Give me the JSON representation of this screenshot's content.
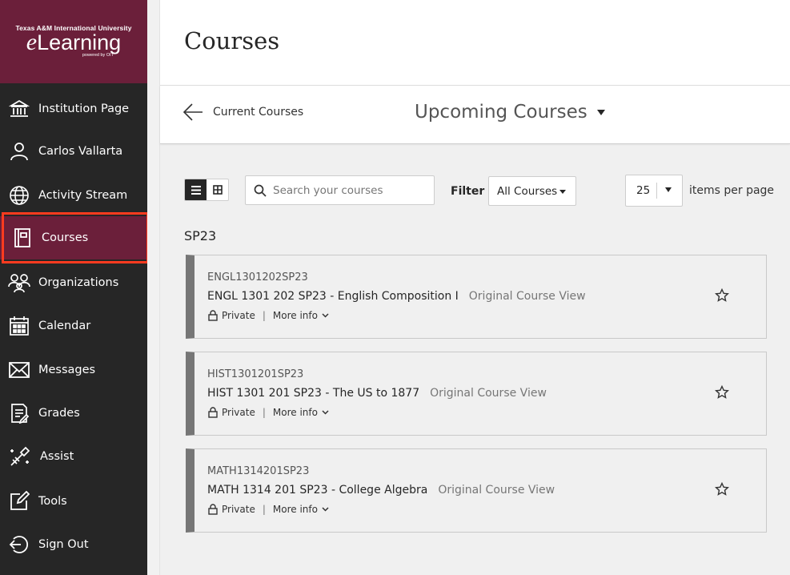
{
  "brand": {
    "university": "Texas A&M International University",
    "product_initial": "e",
    "product_rest": "Learning",
    "powered_by": "powered by OIT"
  },
  "sidebar": {
    "items": [
      {
        "label": "Institution Page",
        "icon": "institution-icon"
      },
      {
        "label": "Carlos Vallarta",
        "icon": "user-icon"
      },
      {
        "label": "Activity Stream",
        "icon": "globe-icon"
      },
      {
        "label": "Courses",
        "icon": "courses-icon",
        "active": true
      },
      {
        "label": "Organizations",
        "icon": "organizations-icon"
      },
      {
        "label": "Calendar",
        "icon": "calendar-icon"
      },
      {
        "label": "Messages",
        "icon": "envelope-icon"
      },
      {
        "label": "Grades",
        "icon": "grades-icon"
      },
      {
        "label": "Assist",
        "icon": "assist-icon"
      },
      {
        "label": "Tools",
        "icon": "tools-icon"
      },
      {
        "label": "Sign Out",
        "icon": "sign-out-icon"
      }
    ]
  },
  "header": {
    "title": "Courses",
    "back_label": "Current Courses",
    "term_selector": "Upcoming Courses"
  },
  "toolbar": {
    "search_placeholder": "Search your courses",
    "filter_label": "Filter",
    "filter_value": "All Courses",
    "per_page_value": "25",
    "per_page_label": "items per page"
  },
  "term_group": "SP23",
  "courses": [
    {
      "id": "ENGL1301202SP23",
      "title": "ENGL 1301 202 SP23 - English Composition I",
      "view": "Original Course View",
      "privacy": "Private",
      "more": "More info"
    },
    {
      "id": "HIST1301201SP23",
      "title": "HIST 1301 201 SP23 - The US to 1877",
      "view": "Original Course View",
      "privacy": "Private",
      "more": "More info"
    },
    {
      "id": "MATH1314201SP23",
      "title": "MATH 1314 201 SP23 - College Algebra",
      "view": "Original Course View",
      "privacy": "Private",
      "more": "More info"
    }
  ],
  "colors": {
    "brand": "#6b1f3a",
    "sidebar_bg": "#262626",
    "highlight_box": "#ff3b1f",
    "card_accent": "#767676"
  }
}
